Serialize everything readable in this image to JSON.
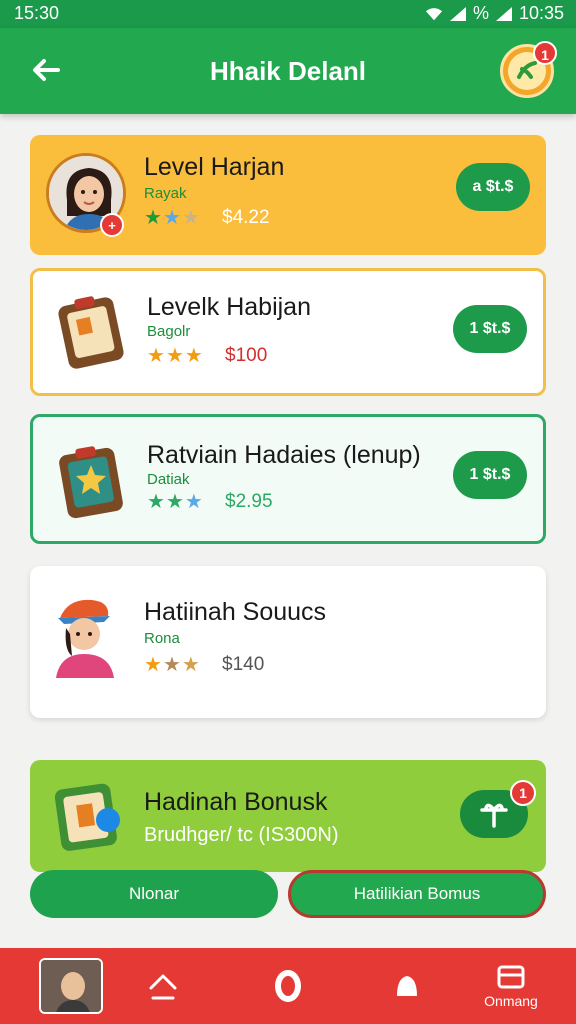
{
  "status": {
    "time": "15:30",
    "battery": "%",
    "clock": "10:35"
  },
  "header": {
    "title": "Hhaik Delanl",
    "coin_badge": "1"
  },
  "cards": [
    {
      "title": "Level Harjan",
      "subtitle": "Rayak",
      "price": "$4.22",
      "button": "a $t.$",
      "rating": 2.5,
      "badge": "+"
    },
    {
      "title": "Levelk Habijan",
      "subtitle": "Bagolr",
      "price": "$100",
      "button": "1 $t.$",
      "rating": 3
    },
    {
      "title": "Ratviain Hadaies (lenup)",
      "subtitle": "Datiak",
      "price": "$2.95",
      "button": "1 $t.$",
      "rating": 3
    },
    {
      "title": "Hatiinah Souucs",
      "subtitle": "Rona",
      "price": "$140",
      "rating": 2.5
    }
  ],
  "bonus": {
    "title": "Hadinah Bonusk",
    "subtitle": "Brudhger/ tc (IS300N)",
    "badge": "1"
  },
  "buttons": {
    "left": "Nlonar",
    "right": "Hatilikian Bomus"
  },
  "nav": {
    "last_label": "Onmang"
  },
  "colors": {
    "primary_green": "#22a84f",
    "accent_yellow": "#fbbd3c",
    "nav_red": "#e53935",
    "bonus_green": "#8fcd3c"
  }
}
